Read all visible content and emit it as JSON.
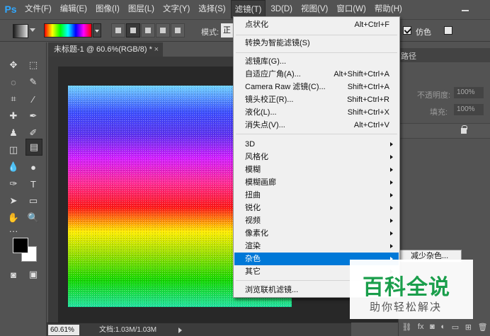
{
  "menubar": {
    "logo": "Ps",
    "items": [
      {
        "label": "文件(F)"
      },
      {
        "label": "编辑(E)"
      },
      {
        "label": "图像(I)"
      },
      {
        "label": "图层(L)"
      },
      {
        "label": "文字(Y)"
      },
      {
        "label": "选择(S)"
      },
      {
        "label": "滤镜(T)"
      },
      {
        "label": "3D(D)"
      },
      {
        "label": "视图(V)"
      },
      {
        "label": "窗口(W)"
      },
      {
        "label": "帮助(H)"
      }
    ]
  },
  "options": {
    "mode_label": "模式:",
    "mode_value": "正",
    "dither_label": "仿色",
    "dither_checked": true,
    "transparency_checked": false
  },
  "document": {
    "tab_title": "未标题-1 @ 60.6%(RGB/8) *",
    "close": "×"
  },
  "status": {
    "zoom": "60.61%",
    "doc_size": "文档:1.03M/1.03M"
  },
  "panel": {
    "paths_tab": "路径",
    "opacity_label": "不透明度:",
    "opacity_value": "100%",
    "fill_label": "填充:",
    "fill_value": "100%"
  },
  "filter_menu": {
    "groups": [
      [
        {
          "label": "点状化",
          "shortcut": "Alt+Ctrl+F"
        }
      ],
      [
        {
          "label": "转换为智能滤镜(S)",
          "shortcut": ""
        }
      ],
      [
        {
          "label": "滤镜库(G)...",
          "shortcut": ""
        },
        {
          "label": "自适应广角(A)...",
          "shortcut": "Alt+Shift+Ctrl+A"
        },
        {
          "label": "Camera Raw 滤镜(C)...",
          "shortcut": "Shift+Ctrl+A"
        },
        {
          "label": "镜头校正(R)...",
          "shortcut": "Shift+Ctrl+R"
        },
        {
          "label": "液化(L)...",
          "shortcut": "Shift+Ctrl+X"
        },
        {
          "label": "消失点(V)...",
          "shortcut": "Alt+Ctrl+V"
        }
      ],
      [
        {
          "label": "3D",
          "submenu": true
        },
        {
          "label": "风格化",
          "submenu": true
        },
        {
          "label": "模糊",
          "submenu": true
        },
        {
          "label": "模糊画廊",
          "submenu": true
        },
        {
          "label": "扭曲",
          "submenu": true
        },
        {
          "label": "锐化",
          "submenu": true
        },
        {
          "label": "视频",
          "submenu": true
        },
        {
          "label": "像素化",
          "submenu": true
        },
        {
          "label": "渲染",
          "submenu": true
        },
        {
          "label": "杂色",
          "submenu": true,
          "highlighted": true
        },
        {
          "label": "其它",
          "submenu": true
        }
      ],
      [
        {
          "label": "浏览联机滤镜...",
          "shortcut": ""
        }
      ]
    ]
  },
  "submenu_peek": "减少杂色...",
  "watermark": {
    "title": "百科全说",
    "subtitle": "助你轻松解决"
  },
  "colors": {
    "accent": "#0078d7",
    "foreground": "#000000",
    "background": "#ffffff",
    "watermark_green": "#1a9e4b"
  }
}
